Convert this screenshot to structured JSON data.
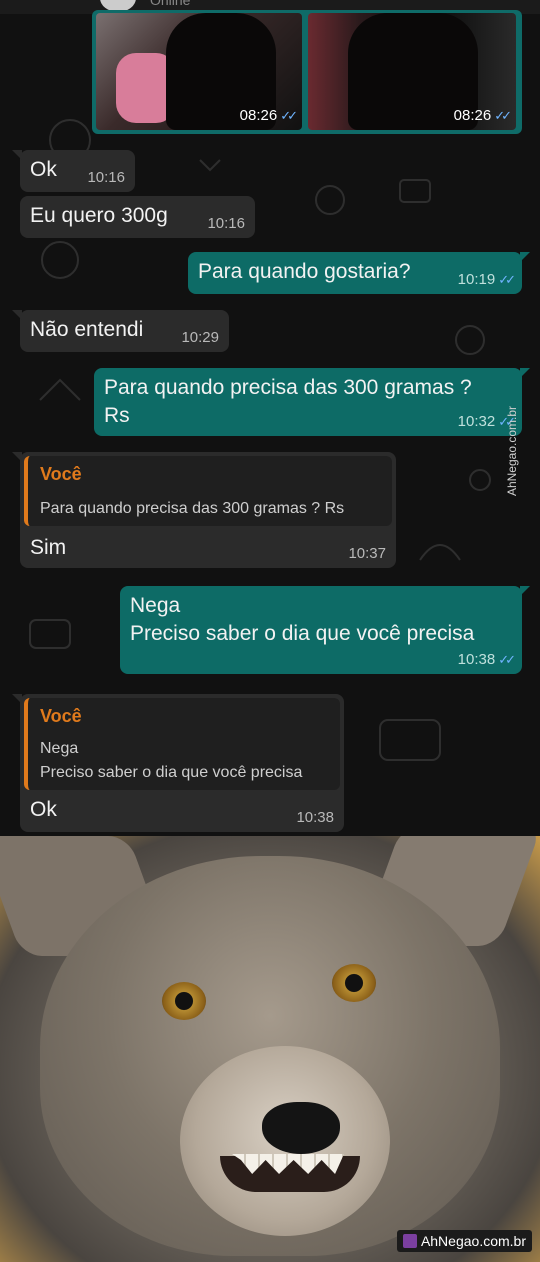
{
  "header": {
    "status": "Online"
  },
  "photos": [
    {
      "time": "08:26",
      "ticks": "✓✓"
    },
    {
      "time": "08:26",
      "ticks": "✓✓"
    }
  ],
  "messages": [
    {
      "text": "Ok",
      "time": "10:16"
    },
    {
      "text": "Eu quero 300g",
      "time": "10:16"
    },
    {
      "text": "Para quando gostaria?",
      "time": "10:19",
      "ticks": "✓✓"
    },
    {
      "text": "Não entendi",
      "time": "10:29"
    },
    {
      "line1": "Para quando precisa das 300 gramas ?",
      "line2": "Rs",
      "time": "10:32",
      "ticks": "✓✓"
    },
    {
      "quote_author": "Você",
      "quote_text": "Para quando precisa das 300 gramas ? Rs",
      "text": "Sim",
      "time": "10:37"
    },
    {
      "line1": "Nega",
      "line2": "Preciso saber o dia que você precisa",
      "time": "10:38",
      "ticks": "✓✓"
    },
    {
      "quote_author": "Você",
      "quote_line1": "Nega",
      "quote_line2": "Preciso saber o dia que você precisa",
      "text": "Ok",
      "time": "10:38"
    }
  ],
  "watermarks": {
    "side": "AhNegao.com.br",
    "bottom": "AhNegao.com.br"
  },
  "colors": {
    "outgoing": "#0d6b66",
    "incoming": "#2b2b2b",
    "quote_accent": "#e07a1c",
    "read_tick": "#6fb4ff"
  }
}
